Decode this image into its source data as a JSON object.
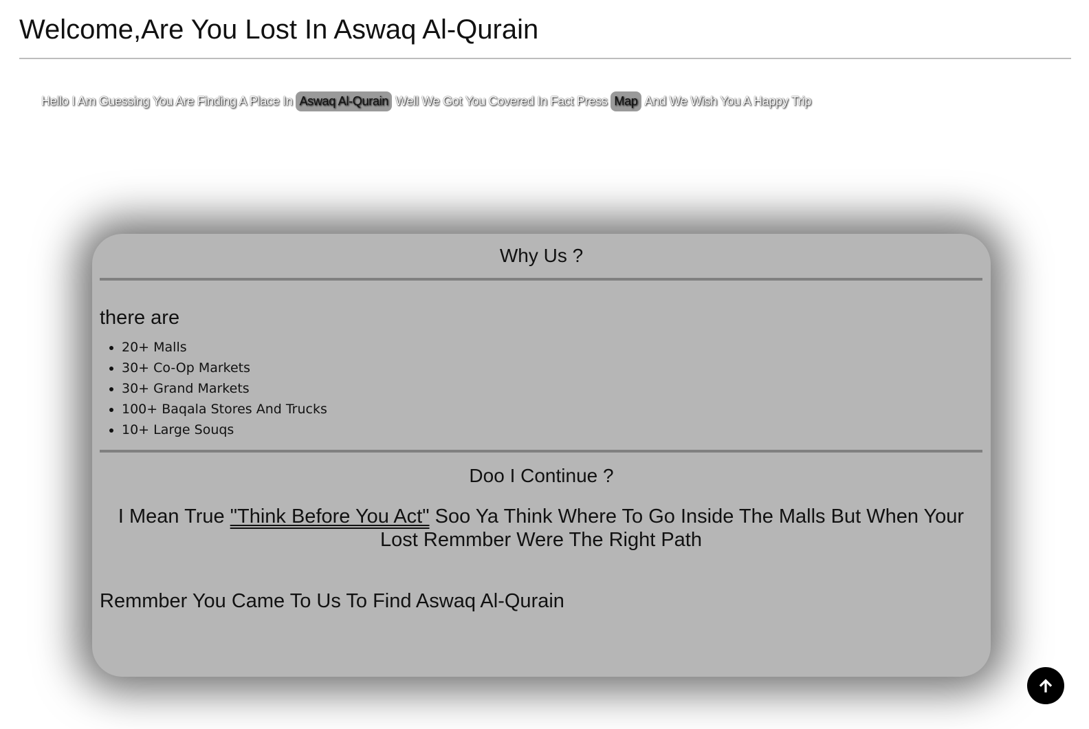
{
  "header": {
    "title": "Welcome,Are You Lost In Aswaq Al-Qurain"
  },
  "intro": {
    "text_before": "Hello I Am Guessing You Are Finding A Place In",
    "place_link": "Aswaq Al-Qurain",
    "text_middle": "Well We Got You Covered In Fact Press",
    "map_link": "Map",
    "text_after": "And We Wish You A Happy Trip"
  },
  "why_us": {
    "heading": "Why Us ?",
    "list_label": "there are",
    "items": [
      "20+ Malls",
      "30+ Co-Op Markets",
      "30+ Grand Markets",
      "100+ Baqala Stores And Trucks",
      "10+ Large Souqs"
    ]
  },
  "continue_section": {
    "heading": "Doo I Continue ?",
    "text_before": "I Mean True",
    "quote": "\"Think Before You Act\"",
    "text_after": "Soo Ya Think Where To Go Inside The Malls But When Your Lost Remmber Were The Right Path",
    "closing": "Remmber You Came To Us To Find Aswaq Al-Qurain"
  },
  "scroll_top": {
    "icon": "arrow-up-icon"
  },
  "colors": {
    "card_background": "#b6b6b6",
    "pill_background": "#9a9a9a",
    "divider": "#808080",
    "scroll_button": "#000000"
  }
}
